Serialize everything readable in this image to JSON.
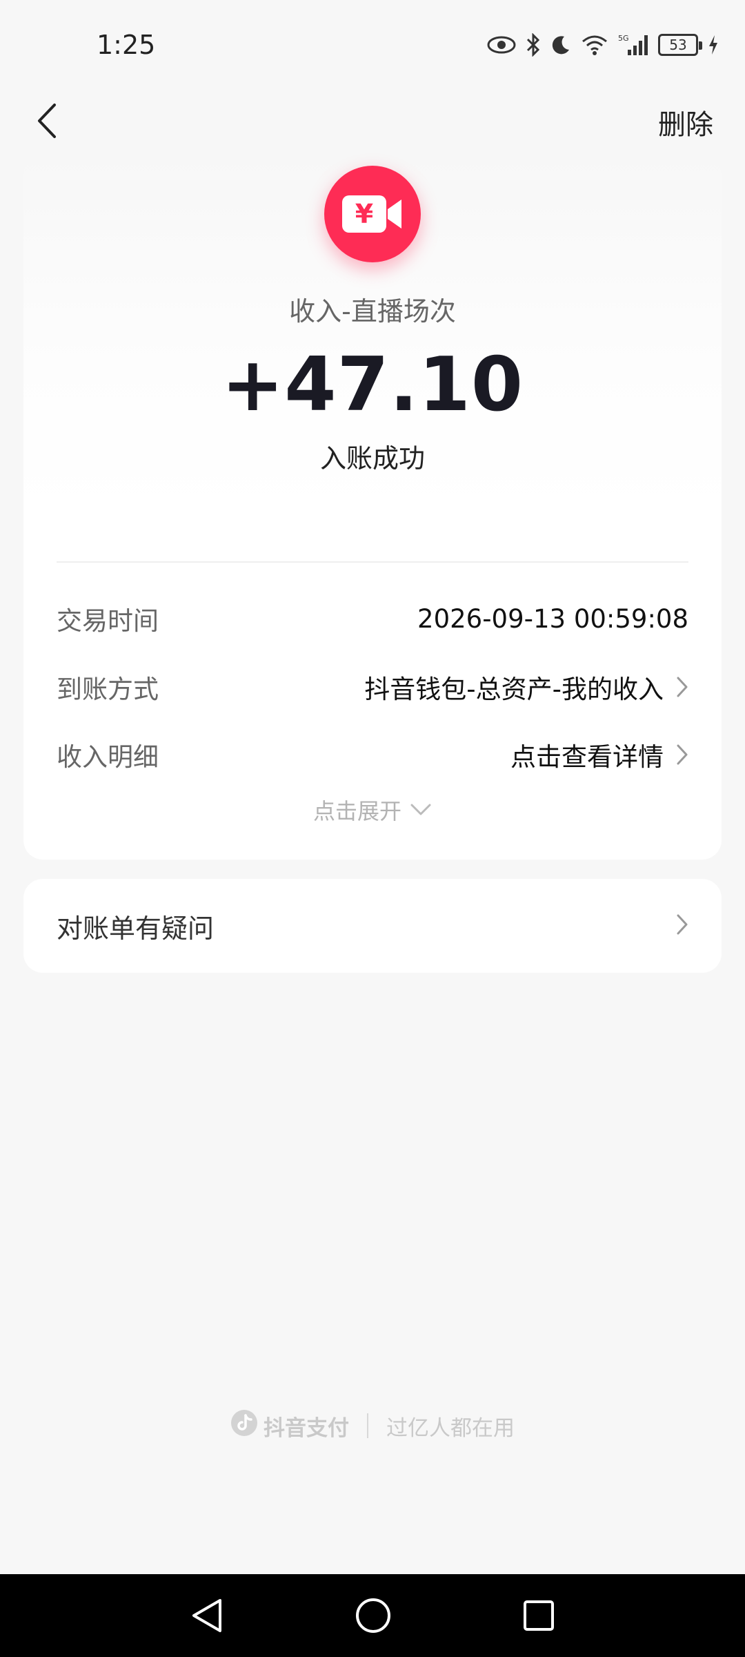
{
  "status_bar": {
    "time": "1:25",
    "battery": "53",
    "network": "5G"
  },
  "top_nav": {
    "delete_label": "删除"
  },
  "transaction": {
    "type": "收入-直播场次",
    "amount": "+47.10",
    "status": "入账成功",
    "logo_symbol": "¥",
    "brand_color": "#fe2c55"
  },
  "details": [
    {
      "label": "交易时间",
      "value": "2026-09-13 00:59:08"
    },
    {
      "label": "到账方式",
      "value": "抖音钱包-总资产-我的收入"
    },
    {
      "label": "收入明细",
      "value": "点击查看详情"
    }
  ],
  "expand_label": "点击展开",
  "question_label": "对账单有疑问",
  "footer": {
    "brand": "抖音支付",
    "slogan": "过亿人都在用"
  }
}
